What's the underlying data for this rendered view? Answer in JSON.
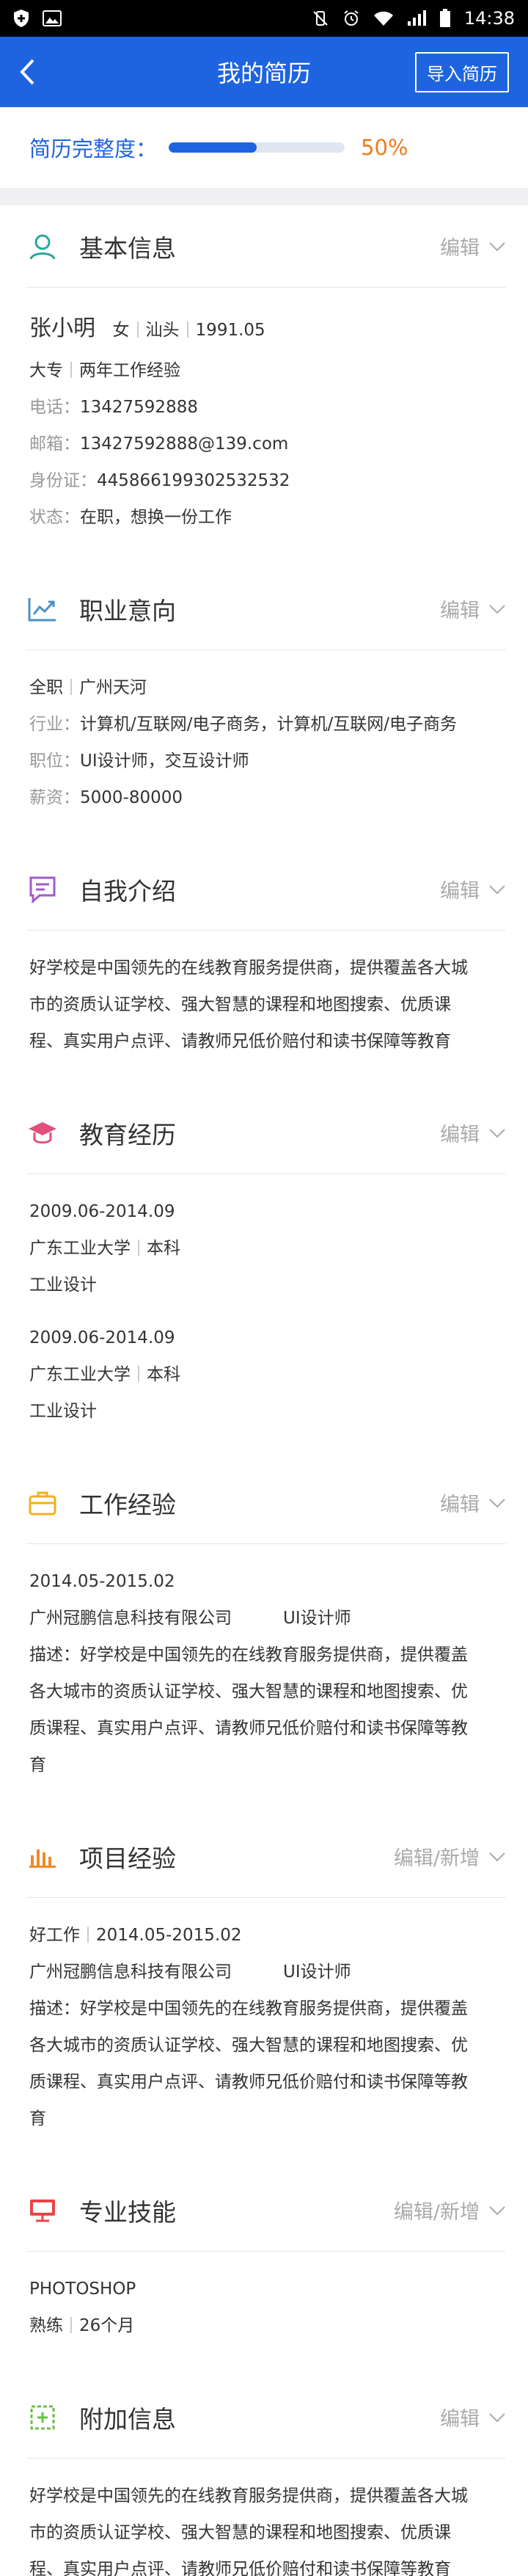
{
  "status_bar": {
    "time": "14:38"
  },
  "nav": {
    "title": "我的简历",
    "import_label": "导入简历"
  },
  "completeness": {
    "label": "简历完整度：",
    "value_text": "50%",
    "percent": 50
  },
  "colors": {
    "brand": "#1e64e0",
    "accent": "#f07c1a",
    "icon_basic": "#2aa79b",
    "icon_intent": "#4a90c8",
    "icon_intro": "#a35bc7",
    "icon_edu": "#e0507a",
    "icon_work": "#f0b021",
    "icon_project": "#f08a2a",
    "icon_skill": "#e84545",
    "icon_extra": "#6cc04a"
  },
  "basic": {
    "title": "基本信息",
    "action": "编辑",
    "icon": "person-icon",
    "name": "张小明",
    "gender": "女",
    "hometown": "汕头",
    "birth": "1991.05",
    "degree": "大专",
    "experience": "两年工作经验",
    "phone_label": "电话：",
    "phone": "13427592888",
    "email_label": "邮箱：",
    "email": "13427592888@139.com",
    "id_label": "身份证：",
    "id_number": "445866199302532532",
    "status_label": "状态：",
    "status": "在职，想换一份工作"
  },
  "intent": {
    "title": "职业意向",
    "action": "编辑",
    "icon": "trend-chart-icon",
    "type": "全职",
    "city": "广州天河",
    "industry_label": "行业：",
    "industry": "计算机/互联网/电子商务，计算机/互联网/电子商务",
    "position_label": "职位：",
    "position": "UI设计师，交互设计师",
    "salary_label": "薪资：",
    "salary": "5000-80000"
  },
  "intro": {
    "title": "自我介绍",
    "action": "编辑",
    "icon": "comment-icon",
    "lines": [
      "好学校是中国领先的在线教育服务提供商，提供覆盖各大城",
      "市的资质认证学校、强大智慧的课程和地图搜索、优质课",
      "程、真实用户点评、请教师兄低价赔付和读书保障等教育"
    ]
  },
  "education": {
    "title": "教育经历",
    "action": "编辑",
    "icon": "graduation-cap-icon",
    "items": [
      {
        "period": "2009.06-2014.09",
        "school": "广东工业大学",
        "level": "本科",
        "major": "工业设计"
      },
      {
        "period": "2009.06-2014.09",
        "school": "广东工业大学",
        "level": "本科",
        "major": "工业设计"
      }
    ]
  },
  "work": {
    "title": "工作经验",
    "action": "编辑",
    "icon": "briefcase-icon",
    "period": "2014.05-2015.02",
    "company": "广州冠鹏信息科技有限公司",
    "position": "UI设计师",
    "desc_lines": [
      "描述：好学校是中国领先的在线教育服务提供商，提供覆盖",
      "各大城市的资质认证学校、强大智慧的课程和地图搜索、优",
      "质课程、真实用户点评、请教师兄低价赔付和读书保障等教",
      "育"
    ]
  },
  "project": {
    "title": "项目经验",
    "action": "编辑/新增",
    "icon": "bar-chart-icon",
    "name": "好工作",
    "period": "2014.05-2015.02",
    "company": "广州冠鹏信息科技有限公司",
    "position": "UI设计师",
    "desc_lines": [
      "描述：好学校是中国领先的在线教育服务提供商，提供覆盖",
      "各大城市的资质认证学校、强大智慧的课程和地图搜索、优",
      "质课程、真实用户点评、请教师兄低价赔付和读书保障等教",
      "育"
    ]
  },
  "skills": {
    "title": "专业技能",
    "action": "编辑/新增",
    "icon": "monitor-icon",
    "name": "PHOTOSHOP",
    "level": "熟练",
    "duration": "26个月"
  },
  "extra": {
    "title": "附加信息",
    "action": "编辑",
    "icon": "plus-box-icon",
    "lines": [
      "好学校是中国领先的在线教育服务提供商，提供覆盖各大城",
      "市的资质认证学校、强大智慧的课程和地图搜索、优质课",
      "程、真实用户点评、请教师兄低价赔付和读书保障等教育"
    ]
  }
}
